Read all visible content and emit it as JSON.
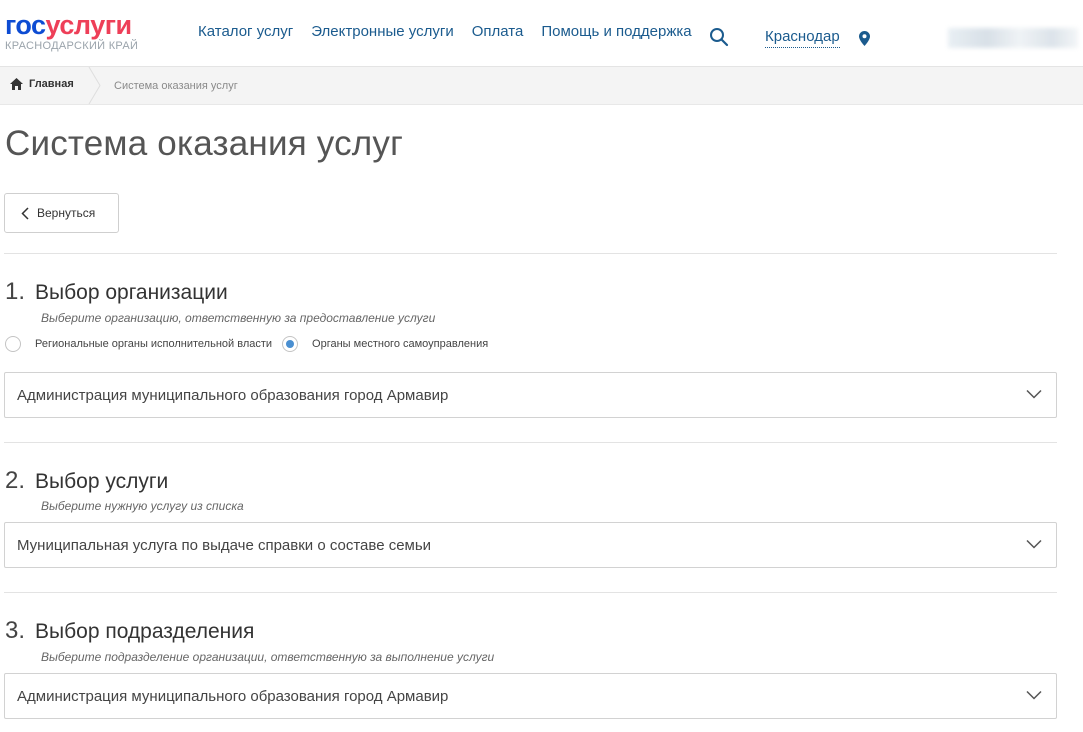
{
  "header": {
    "logo_gos": "гос",
    "logo_uslugi": "услуги",
    "logo_region": "КРАСНОДАРСКИЙ КРАЙ",
    "nav": [
      "Каталог услуг",
      "Электронные услуги",
      "Оплата",
      "Помощь и поддержка"
    ],
    "city": "Краснодар"
  },
  "breadcrumb": {
    "home": "Главная",
    "current": "Система оказания услуг"
  },
  "page_title": "Система оказания услуг",
  "back_label": "Вернуться",
  "sections": [
    {
      "number": "1.",
      "title": "Выбор организации",
      "hint": "Выберите организацию, ответственную за предоставление услуги",
      "radio_options": [
        {
          "label": "Региональные органы исполнительной власти",
          "selected": false
        },
        {
          "label": "Органы местного самоуправления",
          "selected": true
        }
      ],
      "selected_value": "Администрация муниципального образования город Армавир"
    },
    {
      "number": "2.",
      "title": "Выбор услуги",
      "hint": "Выберите нужную услугу из списка",
      "selected_value": "Муниципальная услуга по выдаче справки о составе семьи"
    },
    {
      "number": "3.",
      "title": "Выбор подразделения",
      "hint": "Выберите подразделение организации, ответственную за выполнение услуги",
      "selected_value": "Администрация муниципального образования город Армавир"
    }
  ],
  "colors": {
    "logo_blue": "#0d4cd3",
    "logo_red": "#ee3f58",
    "link": "#1b5b8e",
    "radio_selected": "#4a8fd1"
  }
}
